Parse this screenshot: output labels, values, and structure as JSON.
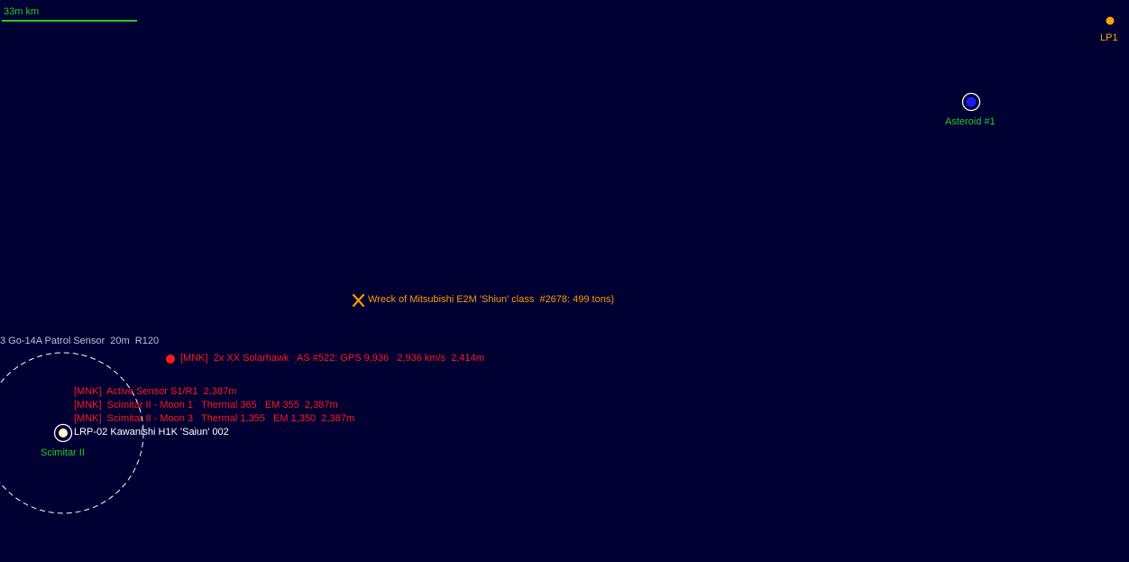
{
  "scale_bar": {
    "label": "33m km",
    "color": "#22cc22"
  },
  "colors": {
    "background": "#000033",
    "body_label": "#22cc22",
    "hostile": "#ff1a1a",
    "wreck": "#ff9900",
    "friendly": "#ffffff",
    "sensor": "#b0c4de",
    "lagrange": "#ffa500",
    "asteroid": "#1a1aff"
  },
  "lagrange_point": {
    "label": "LP1",
    "icon": "lagrange-point-icon"
  },
  "asteroid": {
    "label": "Asteroid #1",
    "icon": "asteroid-icon"
  },
  "wreck": {
    "label": "Wreck of Mitsubishi E2M 'Shiun' class  #2678: 499 tons)",
    "icon": "wreck-x-icon"
  },
  "sensor_range": {
    "label": "3 Go-14A Patrol Sensor  20m  R120"
  },
  "hostile_contact": {
    "label": "[MNK]  2x XX Solarhawk   AS #522: GPS 9,936   2,936 km/s  2,414m",
    "icon": "contact-dot-icon"
  },
  "detections": [
    "[MNK]  Active Sensor S1/R1  2,387m",
    "[MNK]  Scimitar II - Moon 1   Thermal 365   EM 355  2,387m",
    "[MNK]  Scimitar II - Moon 3   Thermal 1,355   EM 1,350  2,387m"
  ],
  "friendly_fleet": {
    "label": "LRP-02 Kawanishi H1K 'Saiun' 002",
    "icon": "fleet-marker-icon"
  },
  "planet": {
    "label": "Scimitar II"
  }
}
